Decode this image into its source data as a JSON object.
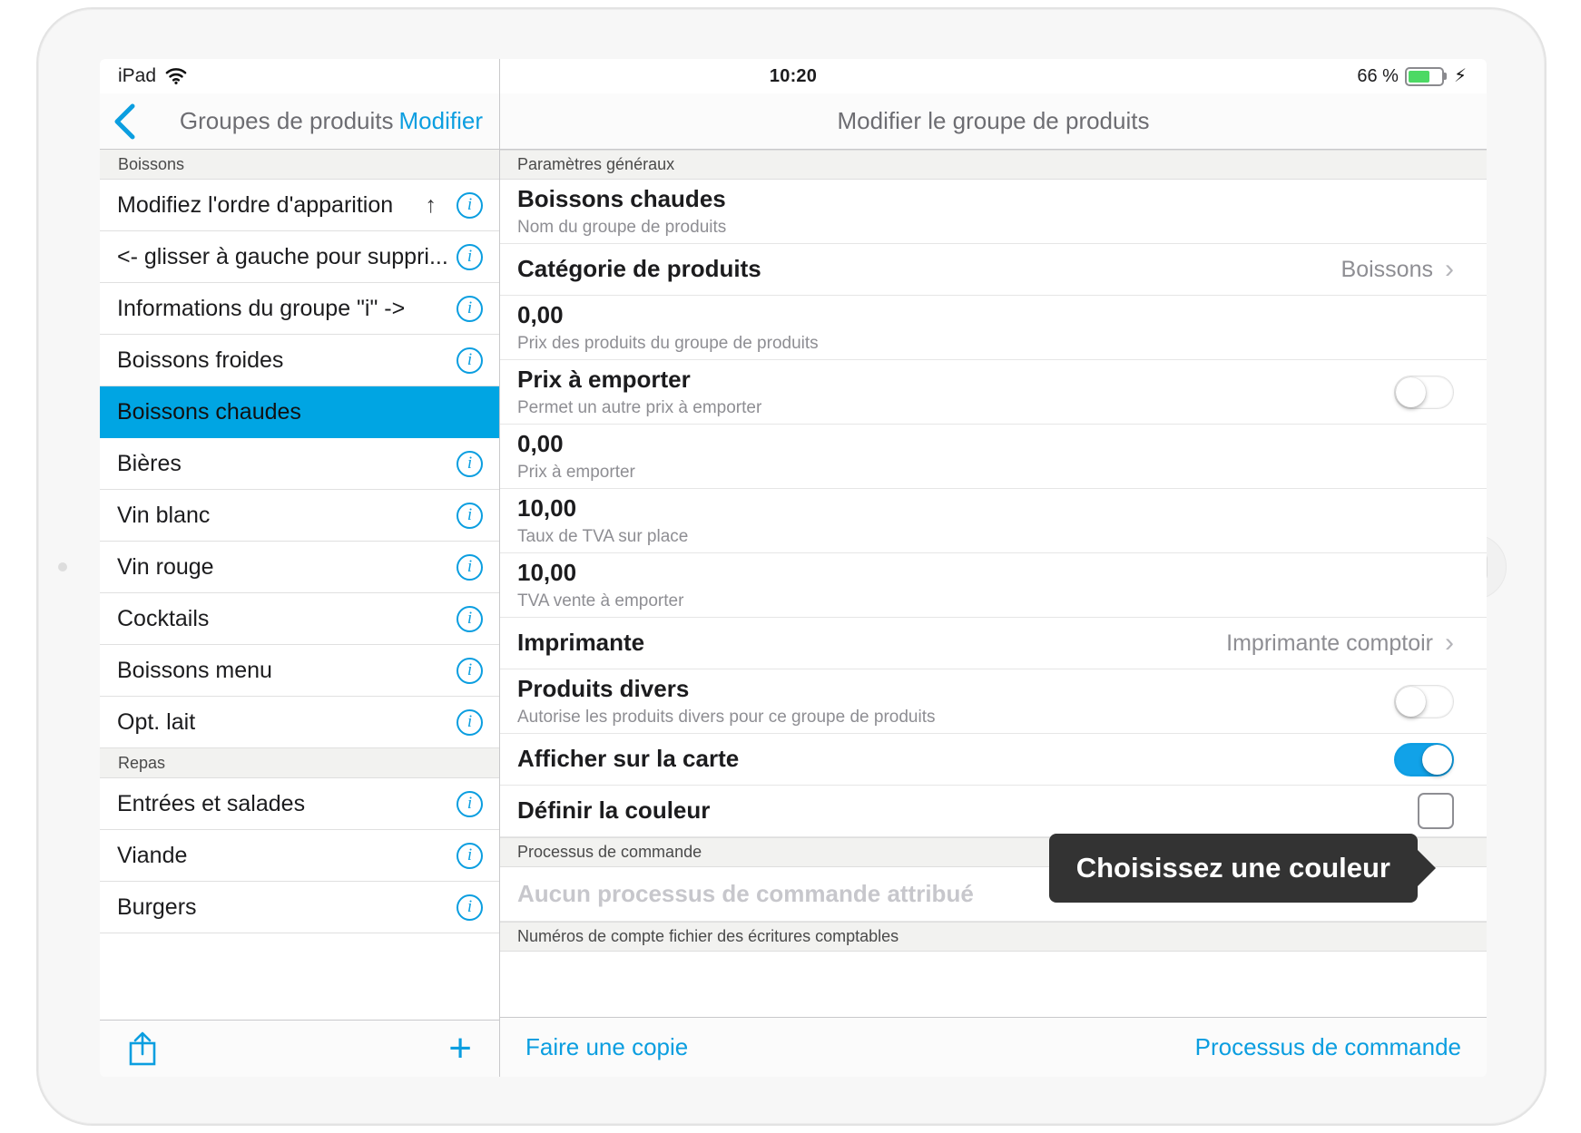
{
  "status_bar": {
    "device": "iPad",
    "wifi_icon": "wifi-icon",
    "time": "10:20",
    "battery_percent": "66 %",
    "charging_icon": "lightning-bolt-icon"
  },
  "sidebar": {
    "back_icon": "chevron-left-icon",
    "title": "Groupes de produits",
    "edit_label": "Modifier",
    "sections": [
      {
        "header": "Boissons",
        "items": [
          {
            "label": "Modifiez l'ordre d'apparition",
            "accessory": "↑",
            "info": "i",
            "selected": false
          },
          {
            "label": "<- glisser à gauche pour suppri...",
            "accessory": "",
            "info": "i",
            "selected": false
          },
          {
            "label": "Informations du groupe \"i\"    ->",
            "accessory": "",
            "info": "i",
            "selected": false
          },
          {
            "label": "Boissons froides",
            "accessory": "",
            "info": "i",
            "selected": false
          },
          {
            "label": "Boissons chaudes",
            "accessory": "",
            "info": "",
            "selected": true
          },
          {
            "label": "Bières",
            "accessory": "",
            "info": "i",
            "selected": false
          },
          {
            "label": "Vin blanc",
            "accessory": "",
            "info": "i",
            "selected": false
          },
          {
            "label": "Vin rouge",
            "accessory": "",
            "info": "i",
            "selected": false
          },
          {
            "label": "Cocktails",
            "accessory": "",
            "info": "i",
            "selected": false
          },
          {
            "label": "Boissons menu",
            "accessory": "",
            "info": "i",
            "selected": false
          },
          {
            "label": "Opt. lait",
            "accessory": "",
            "info": "i",
            "selected": false
          }
        ]
      },
      {
        "header": "Repas",
        "items": [
          {
            "label": "Entrées et salades",
            "accessory": "",
            "info": "i",
            "selected": false
          },
          {
            "label": "Viande",
            "accessory": "",
            "info": "i",
            "selected": false
          },
          {
            "label": "Burgers",
            "accessory": "",
            "info": "i",
            "selected": false
          }
        ]
      }
    ],
    "toolbar": {
      "share_icon": "share-icon",
      "add_icon": "plus-icon"
    }
  },
  "detail": {
    "title": "Modifier le groupe de produits",
    "groups": [
      {
        "header": "Paramètres généraux"
      }
    ],
    "fields": [
      {
        "value": "Boissons chaudes",
        "caption": "Nom du groupe de produits",
        "trailing": "",
        "control": "none"
      },
      {
        "value": "Catégorie de produits",
        "caption": "",
        "trailing": "Boissons",
        "control": "chevron"
      },
      {
        "value": "0,00",
        "caption": "Prix des produits du groupe de produits",
        "trailing": "",
        "control": "none"
      },
      {
        "value": "Prix à emporter",
        "caption": "Permet un autre prix à emporter",
        "trailing": "",
        "control": "toggle-off"
      },
      {
        "value": "0,00",
        "caption": "Prix à emporter",
        "trailing": "",
        "control": "none"
      },
      {
        "value": "10,00",
        "caption": "Taux de TVA sur place",
        "trailing": "",
        "control": "none"
      },
      {
        "value": "10,00",
        "caption": "TVA vente à emporter",
        "trailing": "",
        "control": "none"
      },
      {
        "value": "Imprimante",
        "caption": "",
        "trailing": "Imprimante comptoir",
        "control": "chevron"
      },
      {
        "value": "Produits divers",
        "caption": "Autorise les produits divers pour ce groupe de produits",
        "trailing": "",
        "control": "toggle-off"
      },
      {
        "value": "Afficher sur la carte",
        "caption": "",
        "trailing": "",
        "control": "toggle-on"
      },
      {
        "value": "Définir la couleur",
        "caption": "",
        "trailing": "",
        "control": "colorbox"
      }
    ],
    "order_section": {
      "header": "Processus de commande",
      "placeholder": "Aucun processus de commande attribué"
    },
    "accounting_section": {
      "header": "Numéros de compte fichier des écritures comptables"
    },
    "bottom_bar": {
      "copy_label": "Faire une copie",
      "order_process_label": "Processus de commande"
    },
    "tooltip": {
      "text": "Choisissez une couleur"
    }
  },
  "colors": {
    "accent": "#0b9ee0",
    "selection": "#00a5e3",
    "toggle_on": "#11a2e8",
    "tooltip_bg": "#333333",
    "battery_green": "#4cd964"
  }
}
